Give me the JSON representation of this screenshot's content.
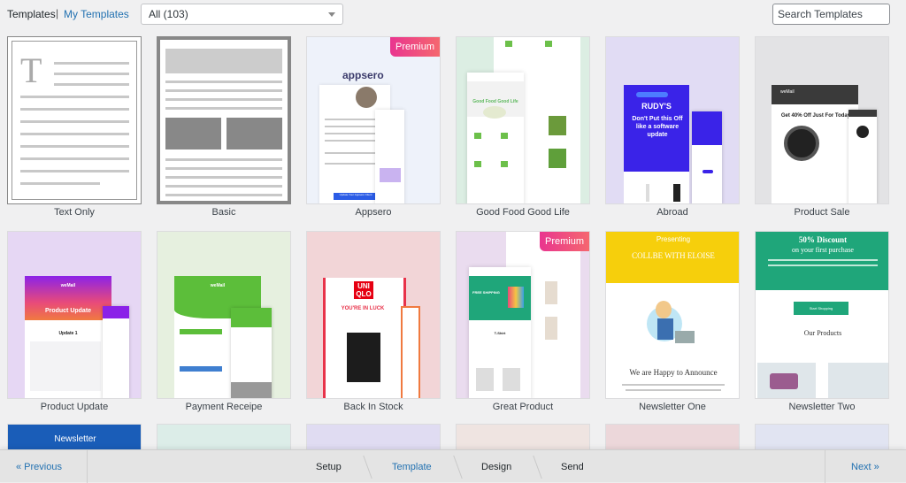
{
  "header": {
    "tab_current": "Templates",
    "separator": "|",
    "tab_my": "My Templates",
    "filter_value": "All (103)",
    "search_placeholder": "Search Templates"
  },
  "badge_label": "Premium",
  "templates": [
    {
      "name": "Text Only"
    },
    {
      "name": "Basic"
    },
    {
      "name": "Appsero",
      "brand": "appsero",
      "button": "Update Your Appsero Client",
      "premium": true
    },
    {
      "name": "Good Food Good Life",
      "headline": "Good Food Good Life"
    },
    {
      "name": "Abroad",
      "brand": "RUDY'S",
      "headline": "Don't Put this Off like a software update"
    },
    {
      "name": "Product Sale",
      "brand": "weMail",
      "headline": "Get 40% Off Just For Today"
    },
    {
      "name": "Product Update",
      "brand": "weMail",
      "headline": "Product Update",
      "sub": "Update 1"
    },
    {
      "name": "Payment Receipe",
      "brand": "weMail"
    },
    {
      "name": "Back In Stock",
      "headline": "YOU'RE IN LUCK",
      "brand": "UNIQLO"
    },
    {
      "name": "Great Product",
      "headline": "FREE SHIPPING",
      "sub": "T-Shirt",
      "premium": true
    },
    {
      "name": "Newsletter One",
      "kicker": "Presenting",
      "headline": "COLLBE WITH ELOISE",
      "sub": "We are Happy to Announce"
    },
    {
      "name": "Newsletter Two",
      "headline": "50% Discount",
      "kicker": "on your first purchase",
      "button": "Start Shopping",
      "sub": "Our Products"
    },
    {
      "headline": "Newsletter"
    },
    {},
    {},
    {},
    {},
    {}
  ],
  "footer": {
    "previous": "« Previous",
    "steps": [
      "Setup",
      "Template",
      "Design",
      "Send"
    ],
    "active_step": "Template",
    "next": "Next »"
  },
  "colors": {
    "accent": "#2271b1",
    "premium": "#e9358f"
  }
}
